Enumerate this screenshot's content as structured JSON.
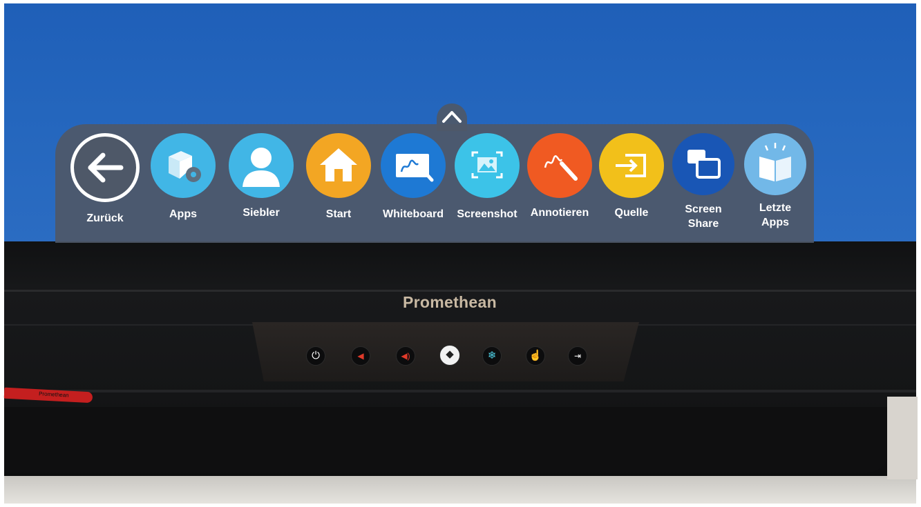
{
  "menu": {
    "items": [
      {
        "label": "Zurück",
        "color": "#4e5868",
        "icon": "arrow-left-icon"
      },
      {
        "label": "Apps",
        "color": "#41b6e6",
        "icon": "apps-box-gear-icon"
      },
      {
        "label": "Siebler",
        "color": "#41b6e6",
        "icon": "user-icon"
      },
      {
        "label": "Start",
        "color": "#f3a623",
        "icon": "home-icon"
      },
      {
        "label": "Whiteboard",
        "color": "#1e79d4",
        "icon": "whiteboard-icon"
      },
      {
        "label": "Screenshot",
        "color": "#3cc3e8",
        "icon": "screenshot-icon"
      },
      {
        "label": "Annotieren",
        "color": "#f05a22",
        "icon": "annotate-pen-icon"
      },
      {
        "label": "Quelle",
        "color": "#f2c01a",
        "icon": "input-source-icon"
      },
      {
        "label": "Screen\nShare",
        "line1": "Screen",
        "line2": "Share",
        "color": "#1956b5",
        "icon": "screen-share-icon"
      },
      {
        "label": "Letzte\nApps",
        "line1": "Letzte",
        "line2": "Apps",
        "color": "#72b8e8",
        "icon": "recent-apps-book-icon"
      }
    ]
  },
  "device": {
    "brand": "Promethean",
    "pen_text": "Promethean"
  }
}
